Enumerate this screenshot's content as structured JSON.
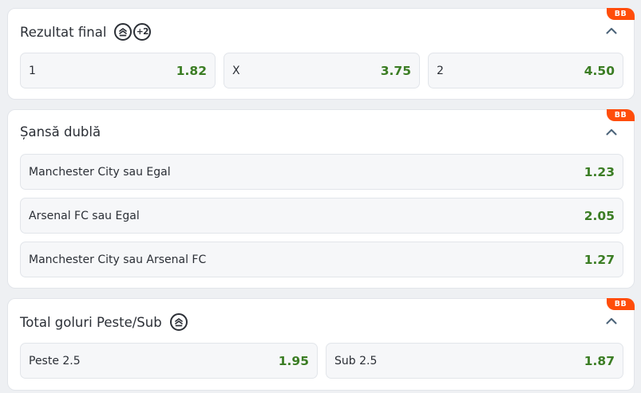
{
  "badge_label": "BB",
  "colors": {
    "odd_value": "#3b7d24",
    "badge": "#ff4d0a",
    "text": "#2b2f36"
  },
  "markets": [
    {
      "title": "Rezultat final",
      "icons": [
        "bet-builder-icon",
        "plus-two-icon"
      ],
      "plus_label": "+2",
      "options": [
        {
          "label": "1",
          "odd": "1.82"
        },
        {
          "label": "X",
          "odd": "3.75"
        },
        {
          "label": "2",
          "odd": "4.50"
        }
      ]
    },
    {
      "title": "Șansă dublă",
      "icons": [],
      "options": [
        {
          "label": "Manchester City sau Egal",
          "odd": "1.23"
        },
        {
          "label": "Arsenal FC sau Egal",
          "odd": "2.05"
        },
        {
          "label": "Manchester City sau Arsenal FC",
          "odd": "1.27"
        }
      ]
    },
    {
      "title": "Total goluri Peste/Sub",
      "icons": [
        "bet-builder-icon"
      ],
      "options": [
        {
          "label": "Peste 2.5",
          "odd": "1.95"
        },
        {
          "label": "Sub 2.5",
          "odd": "1.87"
        }
      ]
    }
  ]
}
